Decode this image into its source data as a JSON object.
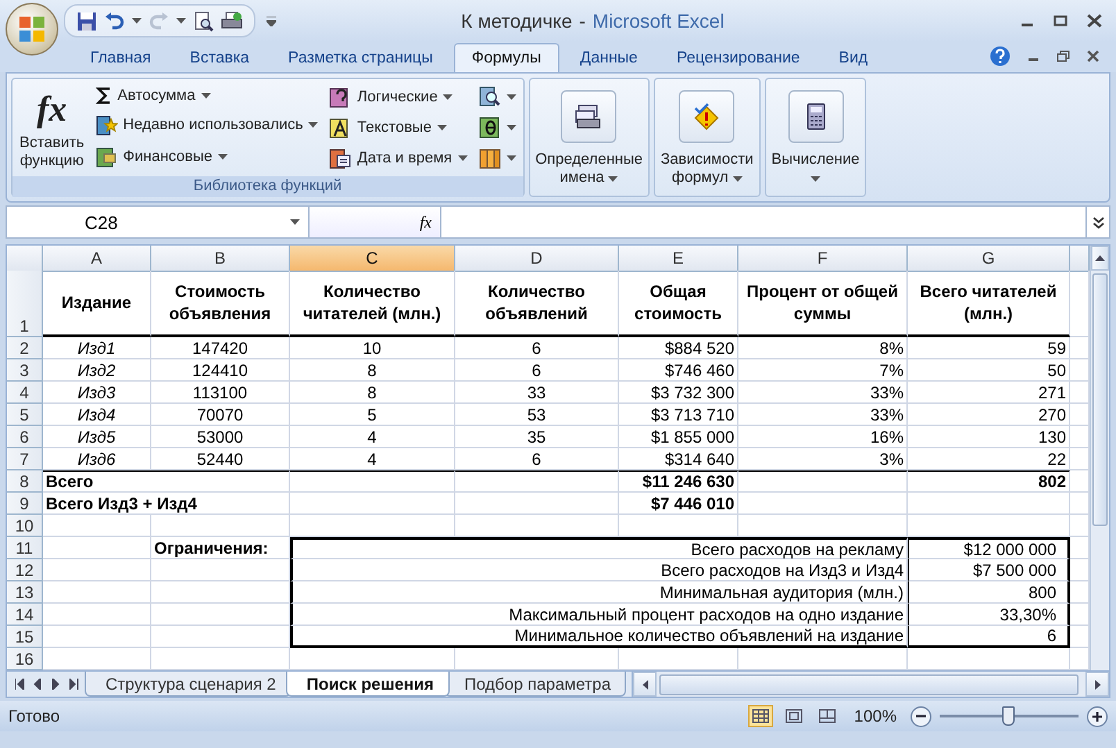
{
  "window": {
    "document": "К методичке",
    "separator": "-",
    "app": "Microsoft Excel"
  },
  "quick_access": {
    "redo_disabled": true
  },
  "tabs": [
    {
      "label": "Главная",
      "selected": false
    },
    {
      "label": "Вставка",
      "selected": false
    },
    {
      "label": "Разметка страницы",
      "selected": false
    },
    {
      "label": "Формулы",
      "selected": true
    },
    {
      "label": "Данные",
      "selected": false
    },
    {
      "label": "Рецензирование",
      "selected": false
    },
    {
      "label": "Вид",
      "selected": false
    }
  ],
  "ribbon": {
    "library": {
      "label": "Библиотека функций",
      "insert": {
        "glyph": "fx",
        "lines": [
          "Вставить",
          "функцию"
        ]
      },
      "columns": [
        [
          {
            "label": "Автосумма",
            "kind": "sum"
          },
          {
            "label": "Недавно использовались",
            "kind": "recent"
          },
          {
            "label": "Финансовые",
            "kind": "finance"
          }
        ],
        [
          {
            "label": "Логические",
            "kind": "logic"
          },
          {
            "label": "Текстовые",
            "kind": "text"
          },
          {
            "label": "Дата и время",
            "kind": "date"
          }
        ],
        [
          {
            "kind": "lookup"
          },
          {
            "kind": "math"
          },
          {
            "kind": "more"
          }
        ]
      ]
    },
    "groups": [
      {
        "kind": "names",
        "lines": [
          "Определенные",
          "имена"
        ]
      },
      {
        "kind": "audit",
        "lines": [
          "Зависимости",
          "формул"
        ]
      },
      {
        "kind": "calc",
        "lines": [
          "Вычисление"
        ]
      }
    ]
  },
  "formula_bar": {
    "name_box": "C28",
    "fx": "fx"
  },
  "columns": [
    {
      "letter": "A",
      "selected": false
    },
    {
      "letter": "B",
      "selected": false
    },
    {
      "letter": "C",
      "selected": true
    },
    {
      "letter": "D",
      "selected": false
    },
    {
      "letter": "E",
      "selected": false
    },
    {
      "letter": "F",
      "selected": false
    },
    {
      "letter": "G",
      "selected": false
    }
  ],
  "rows": [
    {
      "number": "1",
      "kind": "header",
      "cells": [
        "Издание",
        "Стоимость объявления",
        "Количество читателей (млн.)",
        "Количество объявлений",
        "Общая стоимость",
        "Процент от общей суммы",
        "Всего читателей (млн.)"
      ]
    },
    {
      "number": "2",
      "kind": "item",
      "cells": [
        "Изд1",
        "147420",
        "10",
        "6",
        "$884 520",
        "8%",
        "59"
      ]
    },
    {
      "number": "3",
      "kind": "item",
      "cells": [
        "Изд2",
        "124410",
        "8",
        "6",
        "$746 460",
        "7%",
        "50"
      ]
    },
    {
      "number": "4",
      "kind": "item",
      "cells": [
        "Изд3",
        "113100",
        "8",
        "33",
        "$3 732 300",
        "33%",
        "271"
      ]
    },
    {
      "number": "5",
      "kind": "item",
      "cells": [
        "Изд4",
        "70070",
        "5",
        "53",
        "$3 713 710",
        "33%",
        "270"
      ]
    },
    {
      "number": "6",
      "kind": "item",
      "cells": [
        "Изд5",
        "53000",
        "4",
        "35",
        "$1 855 000",
        "16%",
        "130"
      ]
    },
    {
      "number": "7",
      "kind": "item",
      "cells": [
        "Изд6",
        "52440",
        "4",
        "6",
        "$314 640",
        "3%",
        "22"
      ]
    },
    {
      "number": "8",
      "kind": "total",
      "cells": [
        "Всего",
        null,
        null,
        null,
        "$11 246 630",
        null,
        "802"
      ]
    },
    {
      "number": "9",
      "kind": "total",
      "cells": [
        "Всего Изд3 + Изд4",
        null,
        null,
        null,
        "$7 446 010",
        null,
        null
      ]
    },
    {
      "number": "10",
      "kind": "blank",
      "cells": []
    },
    {
      "number": "11",
      "kind": "constraint",
      "cells": [
        null,
        "Ограничения:",
        "Всего расходов на рекламу",
        "$12 000 000"
      ]
    },
    {
      "number": "12",
      "kind": "constraint",
      "cells": [
        null,
        null,
        "Всего расходов на Изд3 и Изд4",
        "$7 500 000"
      ]
    },
    {
      "number": "13",
      "kind": "constraint",
      "cells": [
        null,
        null,
        "Минимальная аудитория (млн.)",
        "800"
      ]
    },
    {
      "number": "14",
      "kind": "constraint",
      "cells": [
        null,
        null,
        "Максимальный процент расходов на одно издание",
        "33,30%"
      ]
    },
    {
      "number": "15",
      "kind": "constraint",
      "cells": [
        null,
        null,
        "Минимальное количество объявлений на издание",
        "6"
      ]
    },
    {
      "number": "16",
      "kind": "blank",
      "cells": []
    }
  ],
  "sheet_tabs": [
    {
      "label": "Структура сценария 2",
      "selected": false
    },
    {
      "label": "Поиск решения",
      "selected": true
    },
    {
      "label": "Подбор параметра",
      "selected": false
    }
  ],
  "status_bar": {
    "status": "Готово",
    "views": [
      {
        "kind": "normal",
        "selected": true
      },
      {
        "kind": "layout",
        "selected": false
      },
      {
        "kind": "pagebreak",
        "selected": false
      }
    ],
    "zoom": "100%",
    "zoom_slider": {
      "level": 0.49
    }
  }
}
